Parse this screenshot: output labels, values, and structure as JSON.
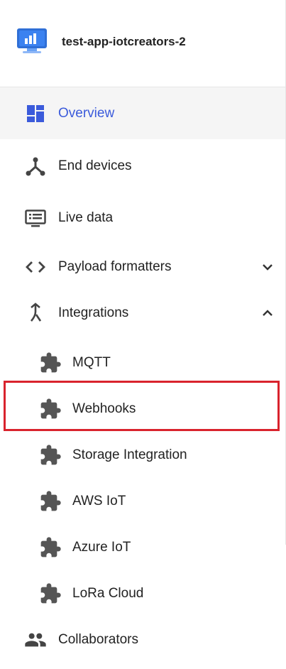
{
  "app": {
    "title": "test-app-iotcreators-2",
    "logo_icon": "app-dashboard-logo",
    "accent_color": "#3b5bdb"
  },
  "nav": {
    "overview": {
      "label": "Overview",
      "icon": "dashboard-icon",
      "active": true
    },
    "end_devices": {
      "label": "End devices",
      "icon": "device-hub-icon"
    },
    "live_data": {
      "label": "Live data",
      "icon": "live-data-icon"
    },
    "payload_formatters": {
      "label": "Payload formatters",
      "icon": "code-icon",
      "expanded": false
    },
    "integrations": {
      "label": "Integrations",
      "icon": "merge-icon",
      "expanded": true,
      "items": [
        {
          "label": "MQTT",
          "icon": "puzzle-icon"
        },
        {
          "label": "Webhooks",
          "icon": "puzzle-icon",
          "highlighted": true
        },
        {
          "label": "Storage Integration",
          "icon": "puzzle-icon"
        },
        {
          "label": "AWS IoT",
          "icon": "puzzle-icon"
        },
        {
          "label": "Azure IoT",
          "icon": "puzzle-icon"
        },
        {
          "label": "LoRa Cloud",
          "icon": "puzzle-icon"
        }
      ]
    },
    "collaborators": {
      "label": "Collaborators",
      "icon": "people-icon"
    }
  },
  "highlight_color": "#d9232d"
}
